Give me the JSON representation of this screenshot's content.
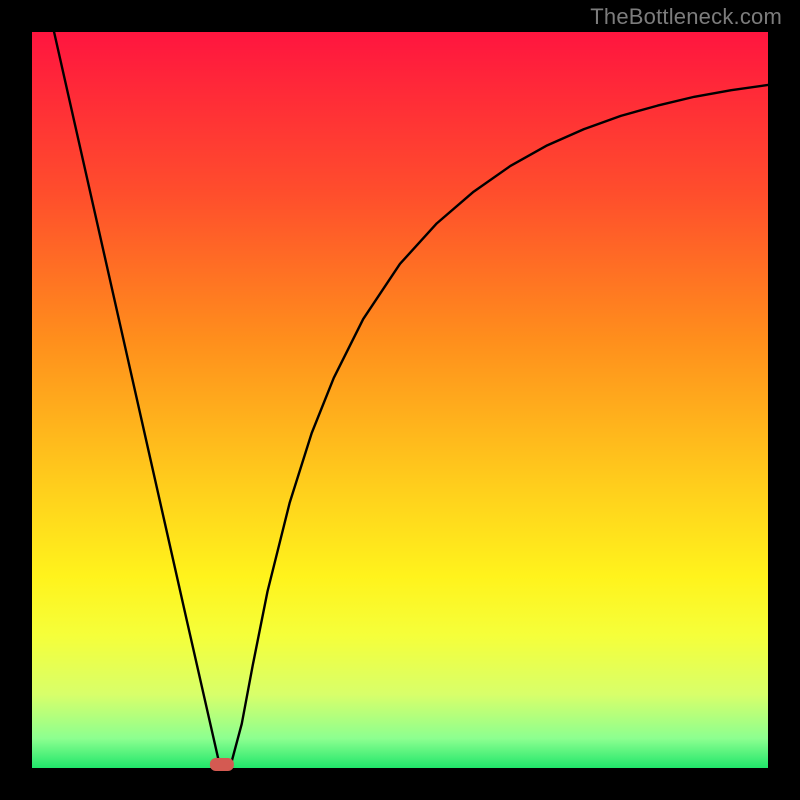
{
  "watermark": "TheBottleneck.com",
  "chart_data": {
    "type": "line",
    "title": "",
    "xlabel": "",
    "ylabel": "",
    "xlim": [
      0,
      100
    ],
    "ylim": [
      0,
      100
    ],
    "grid": false,
    "legend": false,
    "axes_visible": false,
    "background": {
      "type": "vertical_gradient",
      "stops": [
        {
          "offset": 0.0,
          "color": "#ff153f"
        },
        {
          "offset": 0.22,
          "color": "#ff4e2c"
        },
        {
          "offset": 0.42,
          "color": "#ff8f1c"
        },
        {
          "offset": 0.62,
          "color": "#ffcf1c"
        },
        {
          "offset": 0.74,
          "color": "#fff31c"
        },
        {
          "offset": 0.82,
          "color": "#f5ff3a"
        },
        {
          "offset": 0.9,
          "color": "#d8ff6a"
        },
        {
          "offset": 0.96,
          "color": "#8cff90"
        },
        {
          "offset": 1.0,
          "color": "#20e66a"
        }
      ]
    },
    "series": [
      {
        "name": "curve",
        "color": "#000000",
        "x": [
          3.0,
          6.0,
          9.0,
          12.0,
          15.0,
          18.0,
          21.0,
          24.0,
          25.5,
          27.0,
          28.5,
          30.0,
          32.0,
          35.0,
          38.0,
          41.0,
          45.0,
          50.0,
          55.0,
          60.0,
          65.0,
          70.0,
          75.0,
          80.0,
          85.0,
          90.0,
          95.0,
          100.0
        ],
        "y": [
          100.0,
          86.7,
          73.4,
          60.1,
          46.8,
          33.5,
          20.2,
          7.0,
          0.4,
          0.4,
          6.0,
          14.0,
          24.0,
          36.0,
          45.5,
          53.0,
          61.0,
          68.5,
          74.0,
          78.3,
          81.8,
          84.6,
          86.8,
          88.6,
          90.0,
          91.2,
          92.1,
          92.8
        ]
      }
    ],
    "markers": [
      {
        "name": "optimal-point",
        "shape": "rounded-rect",
        "x": 25.8,
        "y": 0.0,
        "color": "#d45a52"
      }
    ]
  }
}
